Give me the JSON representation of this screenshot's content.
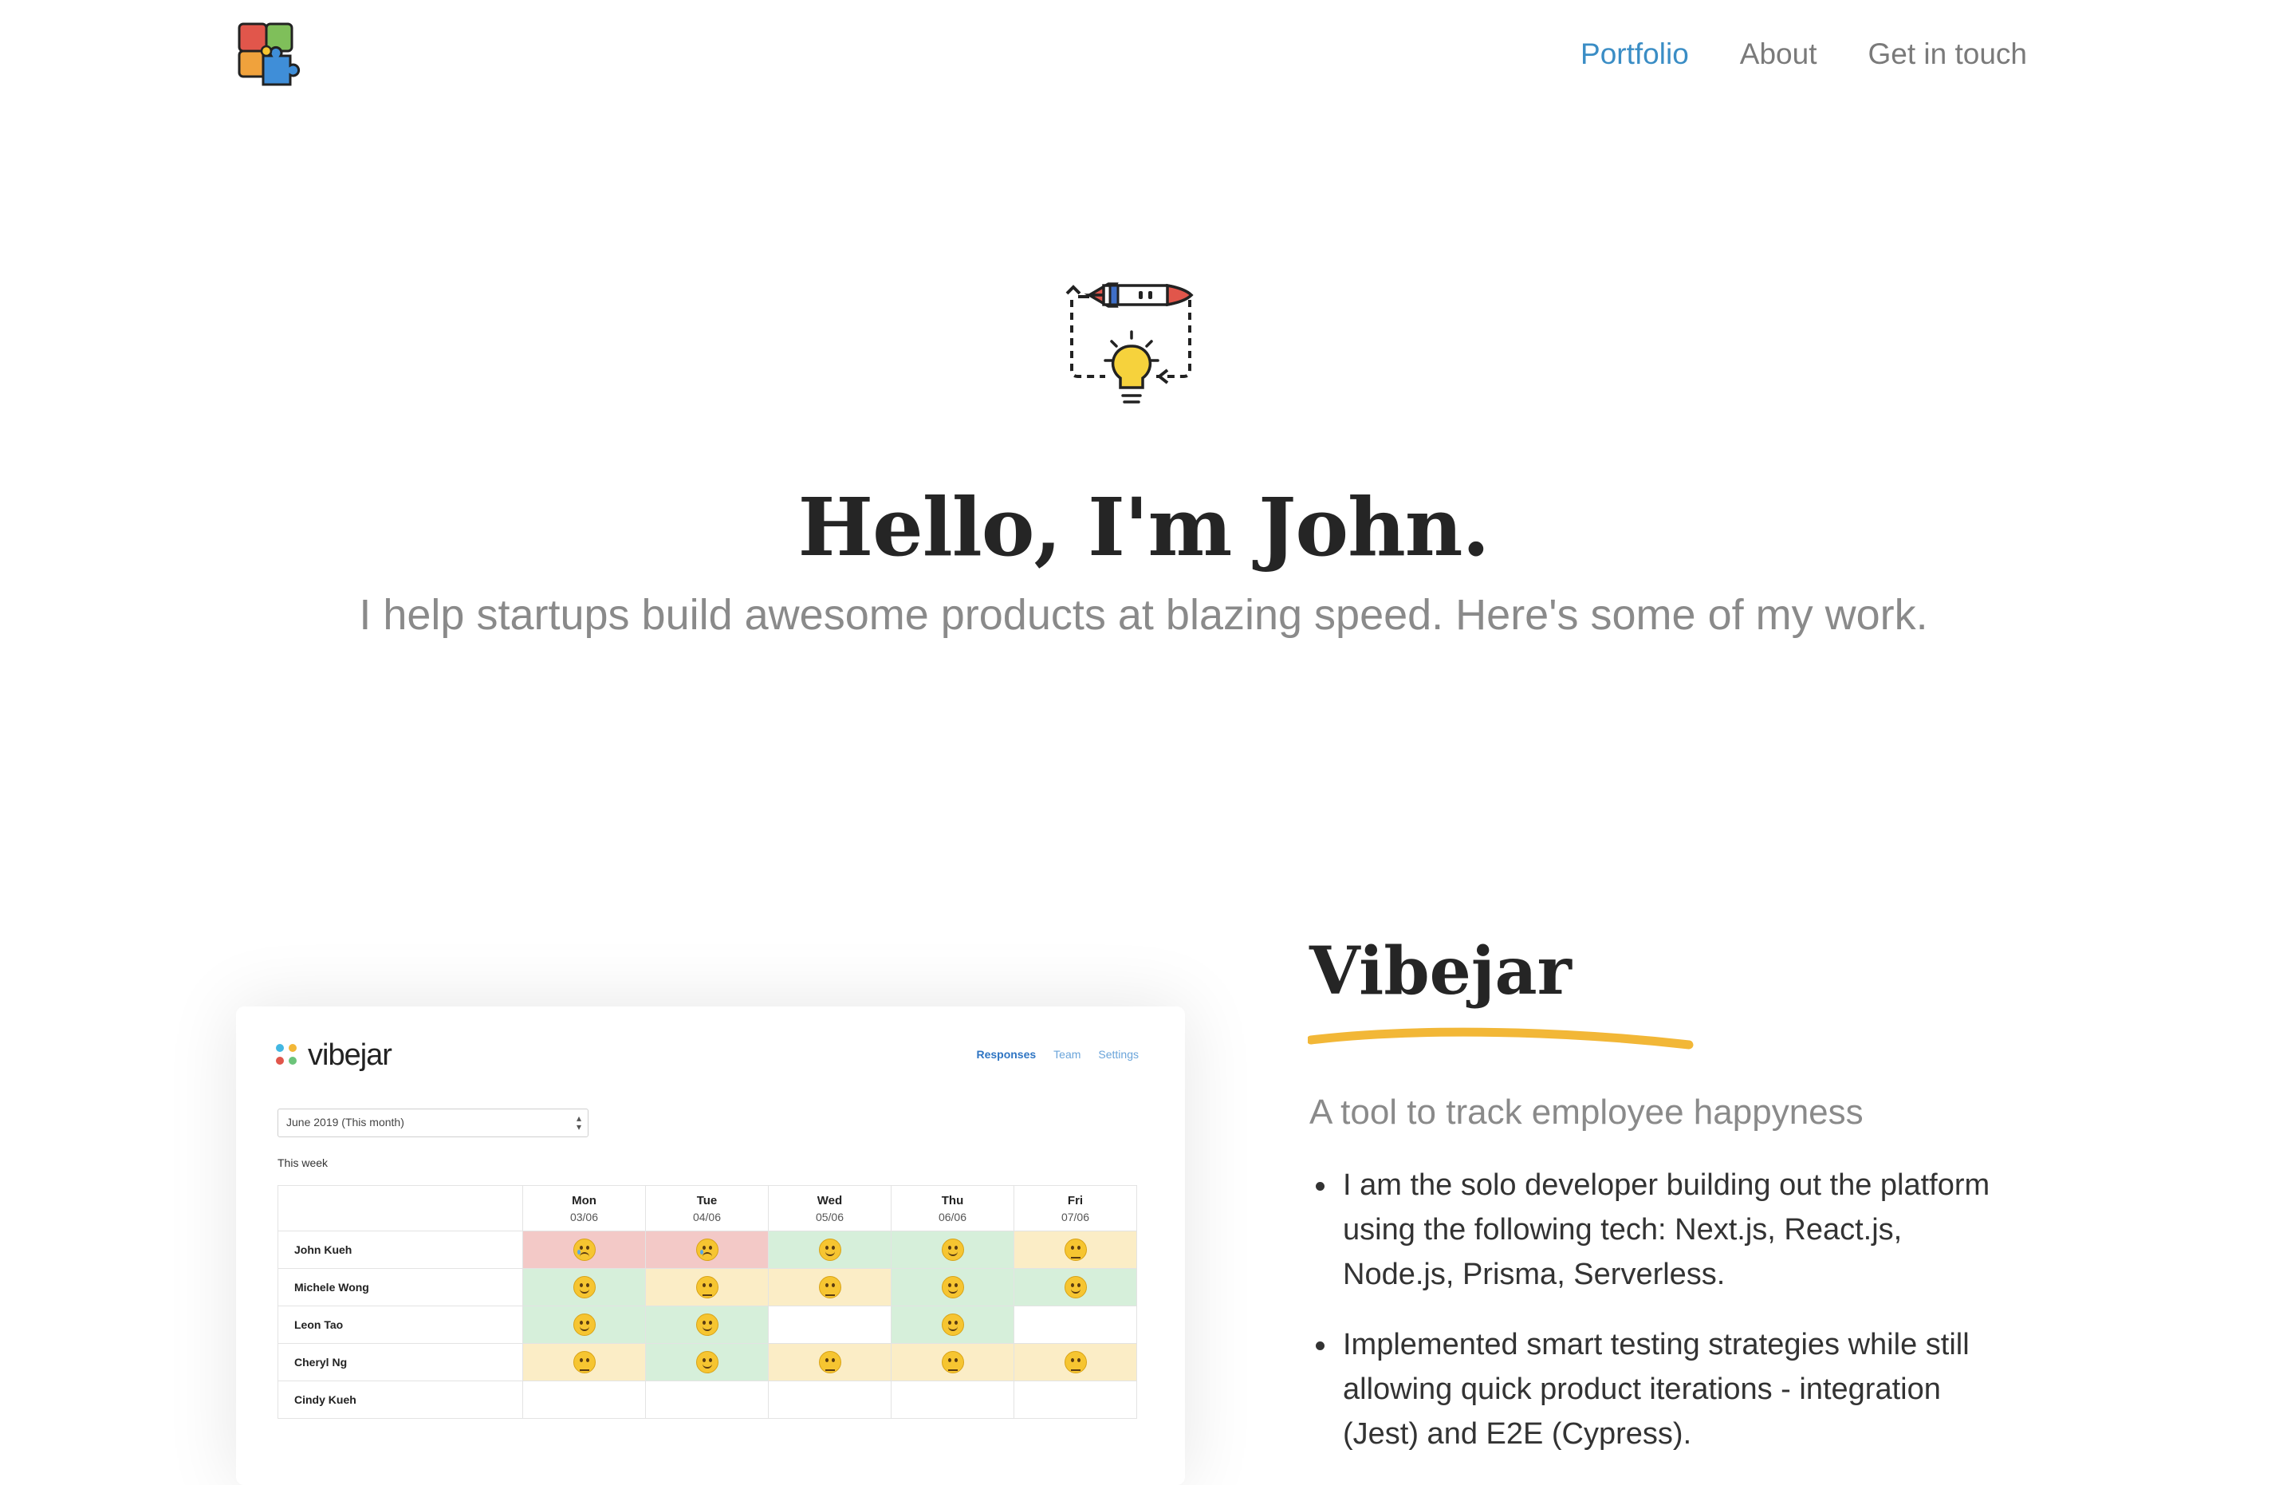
{
  "nav": {
    "logo_icon": "puzzle-pieces-icon",
    "links": [
      {
        "label": "Portfolio",
        "active": true
      },
      {
        "label": "About",
        "active": false
      },
      {
        "label": "Get in touch",
        "active": false
      }
    ]
  },
  "hero": {
    "icon": "rocket-lightbulb-cycle-icon",
    "title": "Hello, I'm John.",
    "subtitle": "I help startups build awesome products at blazing speed. Here's some of my work."
  },
  "project": {
    "title": "Vibejar",
    "underline_color": "#f2b737",
    "subtitle": "A tool to track employee happyness",
    "bullets": [
      "I am the solo developer building out the platform using the following tech: Next.js, React.js, Node.js, Prisma, Serverless.",
      "Implemented smart testing strategies while still allowing quick product iterations - integration (Jest) and E2E (Cypress)."
    ],
    "screenshot": {
      "brand": "vibejar",
      "tabs": [
        {
          "label": "Responses",
          "active": true
        },
        {
          "label": "Team",
          "active": false
        },
        {
          "label": "Settings",
          "active": false
        }
      ],
      "period_select": "June 2019 (This month)",
      "week_label": "This week",
      "days": [
        {
          "day": "Mon",
          "date": "03/06"
        },
        {
          "day": "Tue",
          "date": "04/06"
        },
        {
          "day": "Wed",
          "date": "05/06"
        },
        {
          "day": "Thu",
          "date": "06/06"
        },
        {
          "day": "Fri",
          "date": "07/06"
        }
      ],
      "rows": [
        {
          "name": "John Kueh",
          "moods": [
            "sad",
            "sad",
            "happy",
            "happy",
            "neutral"
          ]
        },
        {
          "name": "Michele Wong",
          "moods": [
            "happy",
            "neutral",
            "neutral",
            "happy",
            "happy"
          ]
        },
        {
          "name": "Leon Tao",
          "moods": [
            "happy",
            "happy",
            "",
            "happy",
            ""
          ]
        },
        {
          "name": "Cheryl Ng",
          "moods": [
            "neutral",
            "happy",
            "neutral",
            "neutral",
            "neutral"
          ]
        },
        {
          "name": "Cindy Kueh",
          "moods": [
            "",
            "",
            "",
            "",
            ""
          ]
        }
      ],
      "mood_colors": {
        "sad": "#f3c9c7",
        "happy": "#d6efda",
        "neutral": "#fbedc6"
      }
    }
  },
  "colors": {
    "accent": "#3a8dc5",
    "muted": "#8a8a8a",
    "heading": "#252525"
  }
}
